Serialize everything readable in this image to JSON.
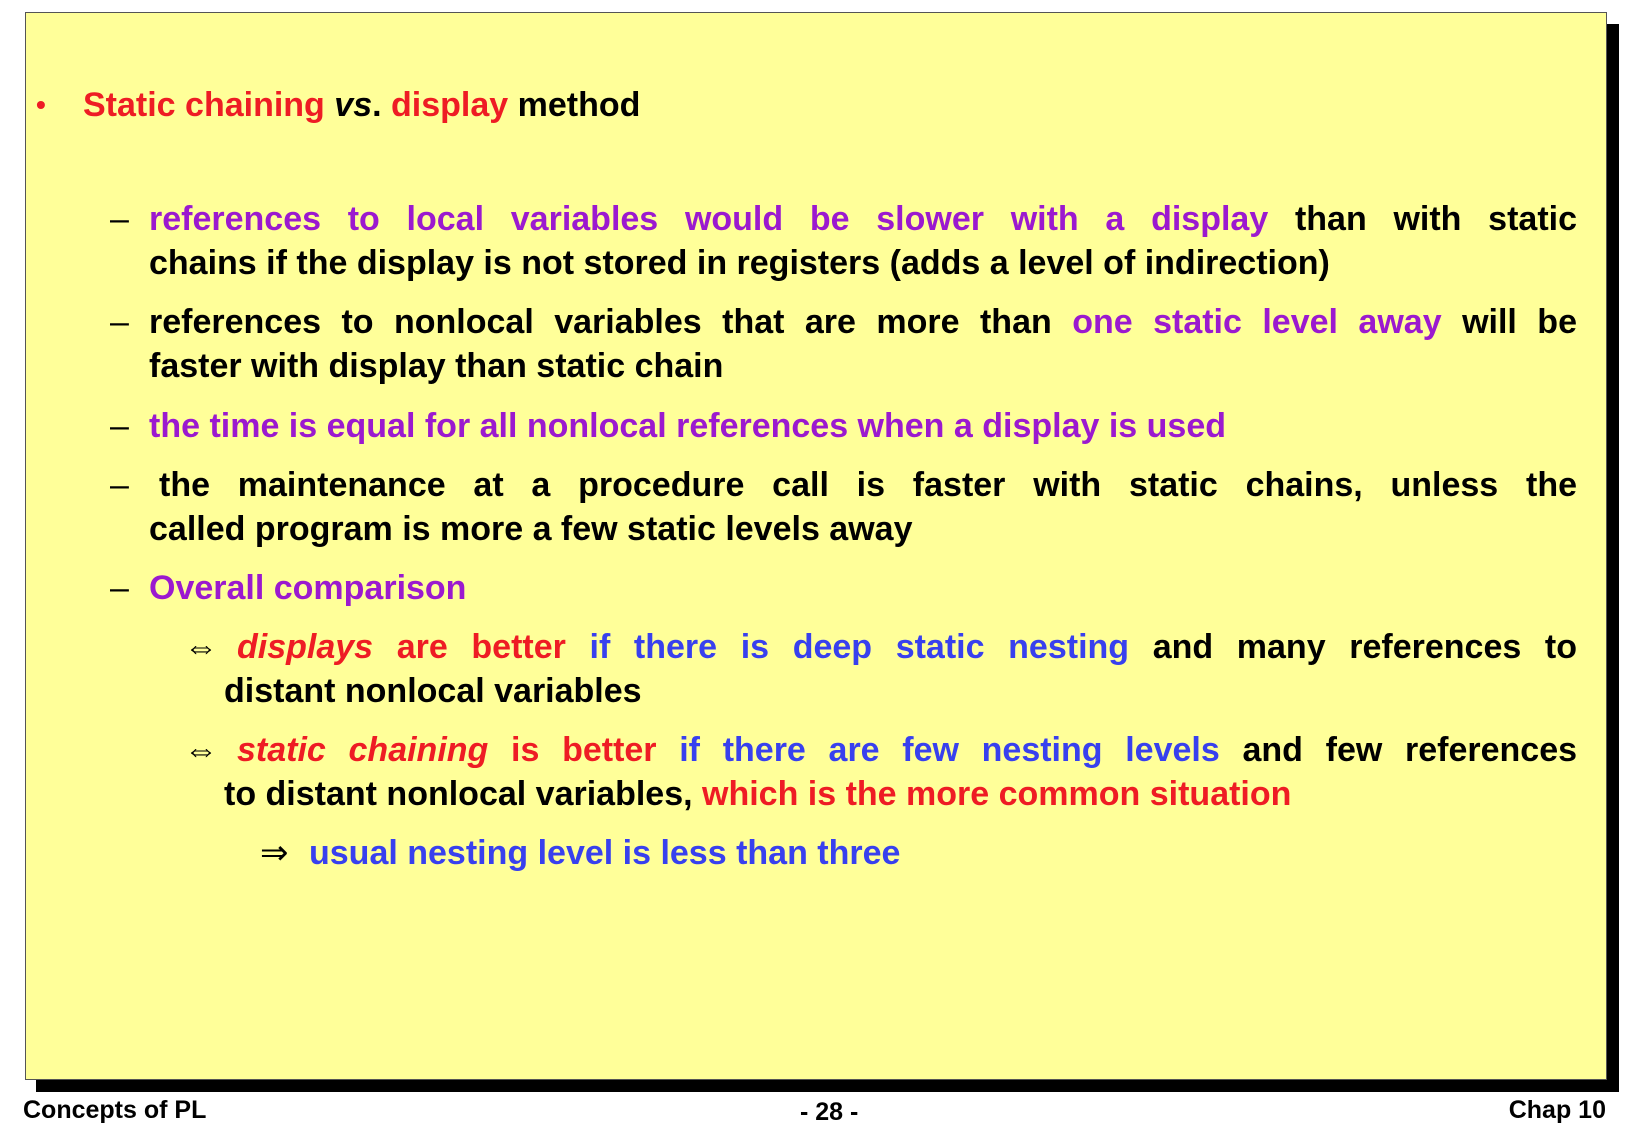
{
  "title": {
    "bullet": "•",
    "part1": "Static chaining",
    "part2": "vs",
    "part3": ".",
    "part4": "display",
    "part5": "method"
  },
  "items": [
    {
      "dash": "–",
      "line1_purple": "references to local variables would be slower with a display",
      "line1_black": "than with static",
      "line2": "chains if the display is not stored in registers (adds a level of indirection)"
    },
    {
      "dash": "–",
      "line1_black": "references to nonlocal variables that are more than",
      "line1_purple": "one static level away",
      "line1_black2": "will be",
      "line2": "faster with display than static chain"
    },
    {
      "dash": "–",
      "line1_purple": "the time is equal for all nonlocal references when a display is used"
    },
    {
      "dash": "–",
      "line1_black": "the maintenance at a procedure call is faster with static chains, unless the",
      "line2": "called program is more a few static levels away"
    },
    {
      "dash": "–",
      "line1_purple": "Overall comparison"
    }
  ],
  "comparisons": [
    {
      "symbol": "⇔",
      "red_italic": "displays",
      "red1": "are better",
      "blue": "if there is deep static nesting",
      "black": "and many references to",
      "line2_black": "distant nonlocal variables"
    },
    {
      "symbol": "⇔",
      "red_italic": "static chaining",
      "red1": "is better",
      "blue": "if there are few nesting levels",
      "black": "and few references",
      "line2_black": "to distant nonlocal variables,",
      "line2_red": "which is the more common situation"
    }
  ],
  "conclusion": {
    "symbol": "⇒",
    "blue": "usual nesting level is less than three"
  },
  "footer": {
    "left": "Concepts of PL",
    "center": "- 28 -",
    "right": "Chap 10"
  }
}
